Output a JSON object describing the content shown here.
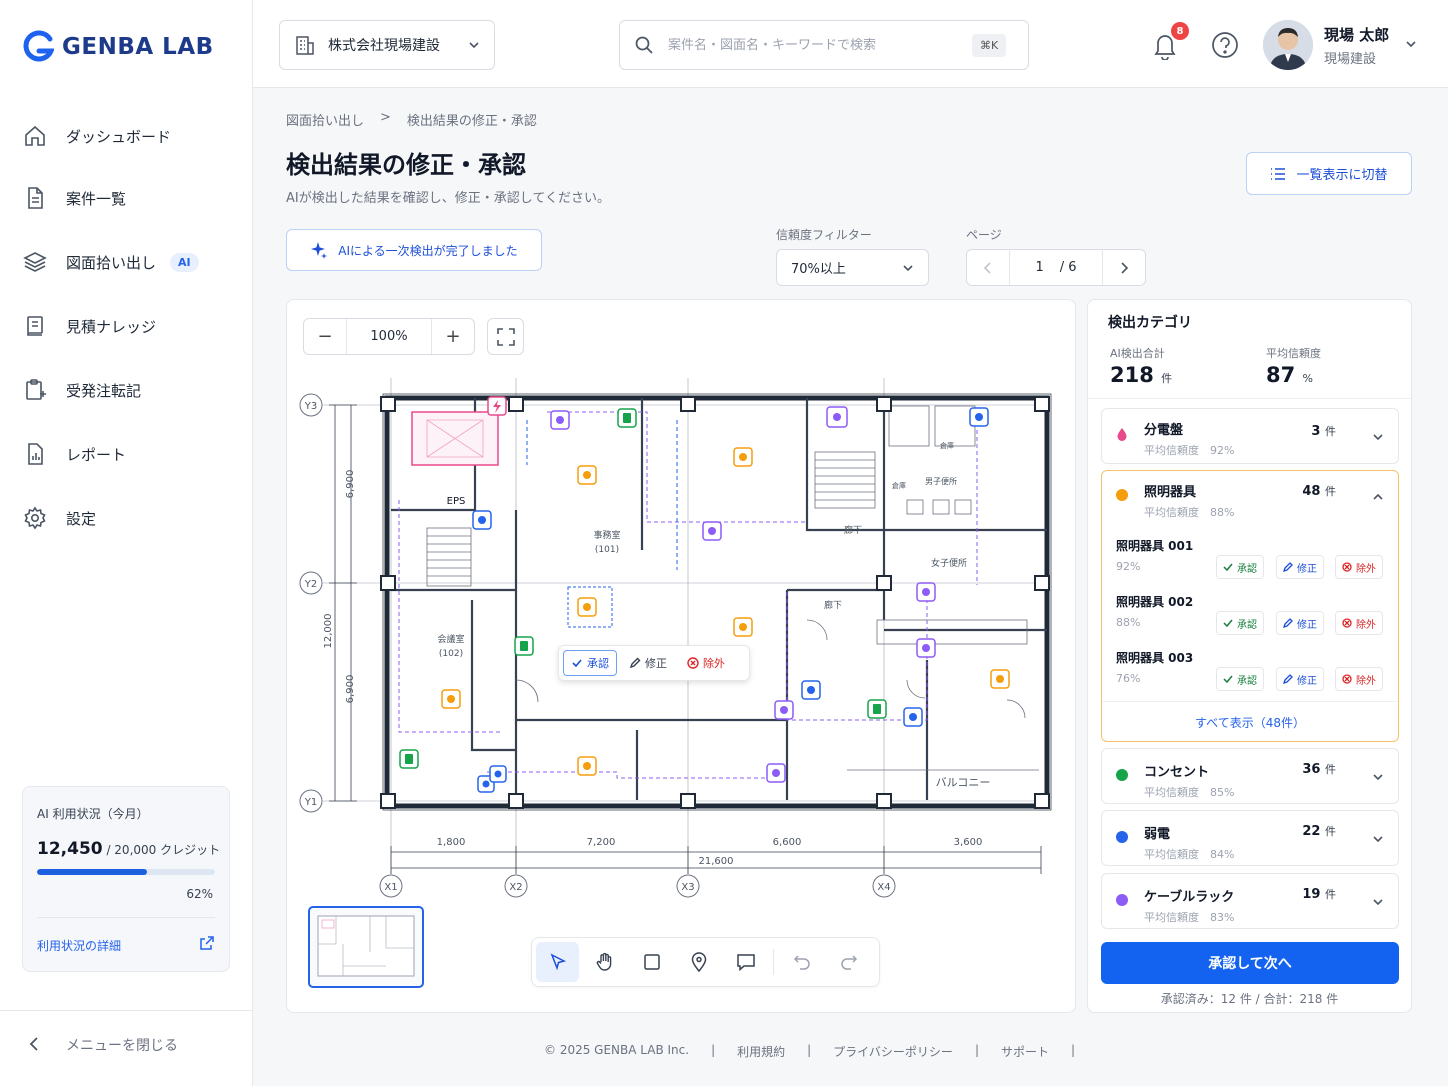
{
  "brand": {
    "name": "GENBA LAB"
  },
  "nav": [
    {
      "label": "ダッシュボード",
      "icon": "home-icon"
    },
    {
      "label": "案件一覧",
      "icon": "document-icon"
    },
    {
      "label": "図面拾い出し",
      "icon": "layers-icon",
      "badge": "AI"
    },
    {
      "label": "見積ナレッジ",
      "icon": "book-icon"
    },
    {
      "label": "受発注転記",
      "icon": "clipboard-icon"
    },
    {
      "label": "レポート",
      "icon": "report-icon"
    },
    {
      "label": "設定",
      "icon": "gear-icon"
    }
  ],
  "usage": {
    "title": "AI 利用状況（今月）",
    "used": "12,450",
    "total": "/ 20,000 クレジット",
    "percent_label": "62%",
    "percent": 62,
    "link": "利用状況の詳細"
  },
  "collapse_label": "メニューを閉じる",
  "header": {
    "company": "株式会社現場建設",
    "search_placeholder": "案件名・図面名・キーワードで検索",
    "shortcut": "⌘K",
    "notifications": "8",
    "user_name": "現場 太郎",
    "user_company": "現場建設"
  },
  "breadcrumb": [
    "図面拾い出し",
    ">",
    "検出結果の修正・承認"
  ],
  "page": {
    "title": "検出結果の修正・承認",
    "subtitle": "AIが検出した結果を確認し、修正・承認してください。",
    "list_toggle": "一覧表示に切替",
    "ai_done": "AIによる一次検出が完了しました",
    "filter_label": "信頼度フィルター",
    "filter_value": "70%以上",
    "page_label": "ページ",
    "page_current": "1",
    "page_total": "/ 6"
  },
  "canvas": {
    "zoom": "100%",
    "action_approve": "承認",
    "action_edit": "修正",
    "action_exclude": "除外",
    "rooms": {
      "office": "事務室",
      "office_no": "(101)",
      "meeting": "会議室",
      "meeting_no": "(102)",
      "eps": "EPS",
      "corridor": "廊下",
      "womens": "女子便所",
      "mens": "男子便所",
      "balcony": "バルコニー",
      "storage1": "倉庫",
      "storage2": "倉庫"
    },
    "dims": {
      "d1": "1,800",
      "d2": "7,200",
      "d3": "6,600",
      "d4": "3,600",
      "total": "21,600",
      "v1": "6,900",
      "v2": "12,000",
      "v3": "6,900"
    },
    "axes_x": [
      "X1",
      "X2",
      "X3",
      "X4"
    ],
    "axes_y": [
      "Y3",
      "Y2",
      "Y1"
    ]
  },
  "panel": {
    "title": "検出カテゴリ",
    "total_label": "AI検出合計",
    "total_value": "218",
    "total_unit": "件",
    "avg_label": "平均信頼度",
    "avg_value": "87",
    "avg_unit": "%",
    "categories": [
      {
        "name": "分電盤",
        "conf": "平均信頼度　92%",
        "count": "3",
        "unit": "件",
        "color": "#e84a8a"
      },
      {
        "name": "照明器具",
        "conf": "平均信頼度　88%",
        "count": "48",
        "unit": "件",
        "color": "#f59e0b"
      },
      {
        "name": "コンセント",
        "conf": "平均信頼度　85%",
        "count": "36",
        "unit": "件",
        "color": "#16a34a"
      },
      {
        "name": "弱電",
        "conf": "平均信頼度　84%",
        "count": "22",
        "unit": "件",
        "color": "#2563eb"
      },
      {
        "name": "ケーブルラック",
        "conf": "平均信頼度　83%",
        "count": "19",
        "unit": "件",
        "color": "#8b5cf6"
      }
    ],
    "items": [
      {
        "name": "照明器具 001",
        "pct": "92%"
      },
      {
        "name": "照明器具 002",
        "pct": "88%"
      },
      {
        "name": "照明器具 003",
        "pct": "76%"
      }
    ],
    "item_approve": "承認",
    "item_edit": "修正",
    "item_exclude": "除外",
    "show_all": "すべて表示（48件）",
    "approve_next": "承認して次へ",
    "approve_meta": "承認済み：12 件 / 合計：218 件"
  },
  "footer": [
    "© 2025 GENBA LAB Inc.",
    "|",
    "利用規約",
    "|",
    "プライバシーポリシー",
    "|",
    "サポート",
    "|"
  ]
}
